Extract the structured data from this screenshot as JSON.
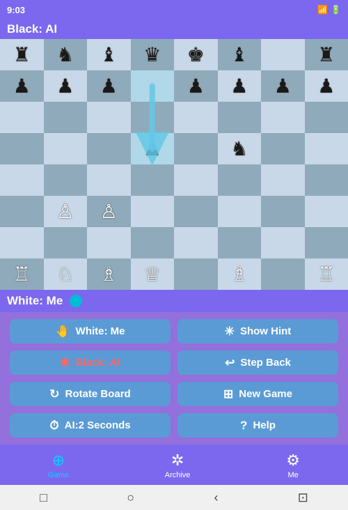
{
  "statusBar": {
    "time": "9:03",
    "icons": "G M G •"
  },
  "topPlayer": {
    "label": "Black: AI"
  },
  "bottomPlayer": {
    "label": "White: Me"
  },
  "buttons": [
    {
      "id": "white-me",
      "icon": "🤚",
      "label": "White: Me",
      "highlight": false
    },
    {
      "id": "show-hint",
      "icon": "✳",
      "label": "Show Hint",
      "highlight": false
    },
    {
      "id": "black-ai",
      "icon": "❋",
      "label": "Black: AI",
      "highlight": true
    },
    {
      "id": "step-back",
      "icon": "↩",
      "label": "Step Back",
      "highlight": false
    },
    {
      "id": "rotate-board",
      "icon": "↻",
      "label": "Rotate Board",
      "highlight": false
    },
    {
      "id": "new-game",
      "icon": "⊞",
      "label": "New Game",
      "highlight": false
    },
    {
      "id": "ai-seconds",
      "icon": "⏱",
      "label": "AI:2 Seconds",
      "highlight": false
    },
    {
      "id": "help",
      "icon": "?",
      "label": "Help",
      "highlight": false
    }
  ],
  "bottomNav": [
    {
      "id": "game",
      "icon": "⊕",
      "label": "Game",
      "active": true
    },
    {
      "id": "archive",
      "icon": "✲",
      "label": "Archive",
      "active": false
    },
    {
      "id": "me",
      "icon": "⚙",
      "label": "Me",
      "active": false
    }
  ],
  "board": {
    "pieces": [
      [
        "♜",
        "♞",
        "♝",
        "♛",
        "♚",
        "♝",
        "",
        "♜"
      ],
      [
        "♟",
        "♟",
        "♟",
        "",
        "♟",
        "♟",
        "♟",
        "♟"
      ],
      [
        "",
        "",
        "",
        "",
        "",
        "",
        "",
        ""
      ],
      [
        "",
        "",
        "",
        "♟",
        "",
        "♞",
        "",
        ""
      ],
      [
        "",
        "",
        "",
        "",
        "",
        "",
        "",
        ""
      ],
      [
        "",
        "♙",
        "♙",
        "",
        "",
        "",
        "",
        ""
      ],
      [
        "",
        "",
        "",
        "",
        "",
        "",
        "",
        ""
      ],
      [
        "♖",
        "♘",
        "♗",
        "♕",
        "",
        "♗",
        "",
        "♖"
      ]
    ],
    "arrowFromRow": 1,
    "arrowFromCol": 3,
    "arrowToRow": 3,
    "arrowToCol": 3
  }
}
